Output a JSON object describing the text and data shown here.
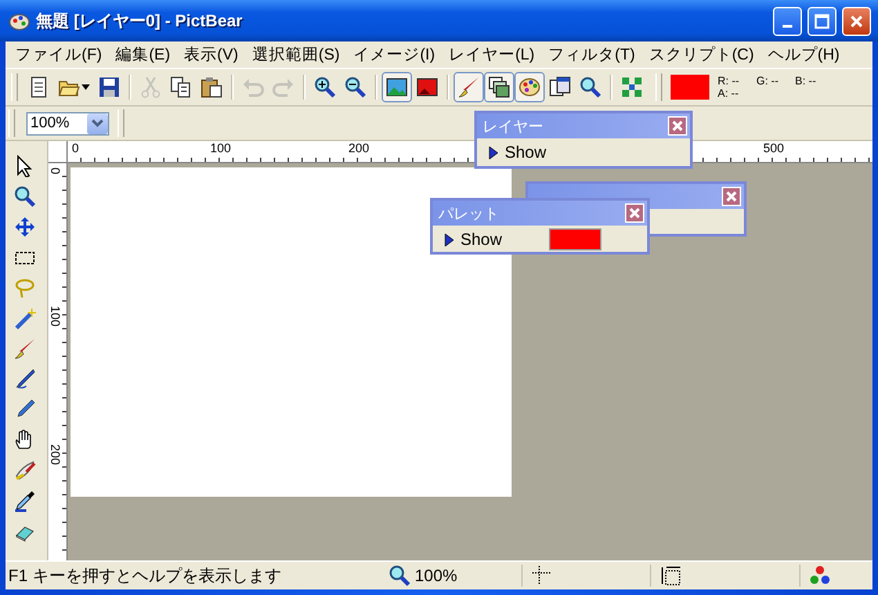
{
  "window": {
    "title": "無題 [レイヤー0] - PictBear"
  },
  "menu": [
    "ファイル(F)",
    "編集(E)",
    "表示(V)",
    "選択範囲(S)",
    "イメージ(I)",
    "レイヤー(L)",
    "フィルタ(T)",
    "スクリプト(C)",
    "ヘルプ(H)"
  ],
  "toolbar_groups": [
    [
      {
        "kind": "new",
        "disabled": false,
        "pressed": false
      },
      {
        "kind": "open",
        "disabled": false,
        "pressed": false
      },
      {
        "kind": "save",
        "disabled": false,
        "pressed": false
      }
    ],
    [
      {
        "kind": "cut",
        "disabled": true,
        "pressed": false
      },
      {
        "kind": "copy",
        "disabled": false,
        "pressed": false
      },
      {
        "kind": "paste",
        "disabled": false,
        "pressed": false
      }
    ],
    [
      {
        "kind": "undo",
        "disabled": true,
        "pressed": false
      },
      {
        "kind": "redo",
        "disabled": true,
        "pressed": false
      }
    ],
    [
      {
        "kind": "zoom-in",
        "disabled": false,
        "pressed": false
      },
      {
        "kind": "zoom-out",
        "disabled": false,
        "pressed": false
      }
    ],
    [
      {
        "kind": "image",
        "disabled": false,
        "pressed": true
      },
      {
        "kind": "red-image",
        "disabled": false,
        "pressed": false
      }
    ],
    [
      {
        "kind": "brush",
        "disabled": false,
        "pressed": true
      },
      {
        "kind": "layers",
        "disabled": false,
        "pressed": true
      },
      {
        "kind": "palette",
        "disabled": false,
        "pressed": true
      },
      {
        "kind": "windows",
        "disabled": false,
        "pressed": false
      },
      {
        "kind": "navigator",
        "disabled": false,
        "pressed": false
      }
    ],
    [
      {
        "kind": "nodes",
        "disabled": false,
        "pressed": false
      }
    ]
  ],
  "current_color": {
    "color": "#ff0000",
    "readouts": [
      "R: --",
      "G: --",
      "B: --",
      "A: --"
    ]
  },
  "zoom_select": {
    "value": "100%"
  },
  "ruler_top": {
    "labels": [
      "0",
      "100",
      "200",
      "500"
    ]
  },
  "ruler_left": {
    "labels": [
      "0",
      "100",
      "200"
    ]
  },
  "tools": [
    {
      "kind": "arrow"
    },
    {
      "kind": "zoom"
    },
    {
      "kind": "move"
    },
    {
      "kind": "select"
    },
    {
      "kind": "lasso"
    },
    {
      "kind": "wand"
    },
    {
      "kind": "brush"
    },
    {
      "kind": "pen"
    },
    {
      "kind": "pencil"
    },
    {
      "kind": "hand"
    },
    {
      "kind": "airbrush"
    },
    {
      "kind": "dropper"
    },
    {
      "kind": "eraser"
    }
  ],
  "panels": [
    {
      "kind": "layer",
      "title": "レイヤー",
      "toggle": "Show"
    },
    {
      "kind": "brush"
    },
    {
      "kind": "palette",
      "title": "パレット",
      "toggle": "Show",
      "color": "#ff0000"
    }
  ],
  "status_bar": {
    "message": "F1 キーを押すとヘルプを表示します",
    "zoom": "100%"
  }
}
